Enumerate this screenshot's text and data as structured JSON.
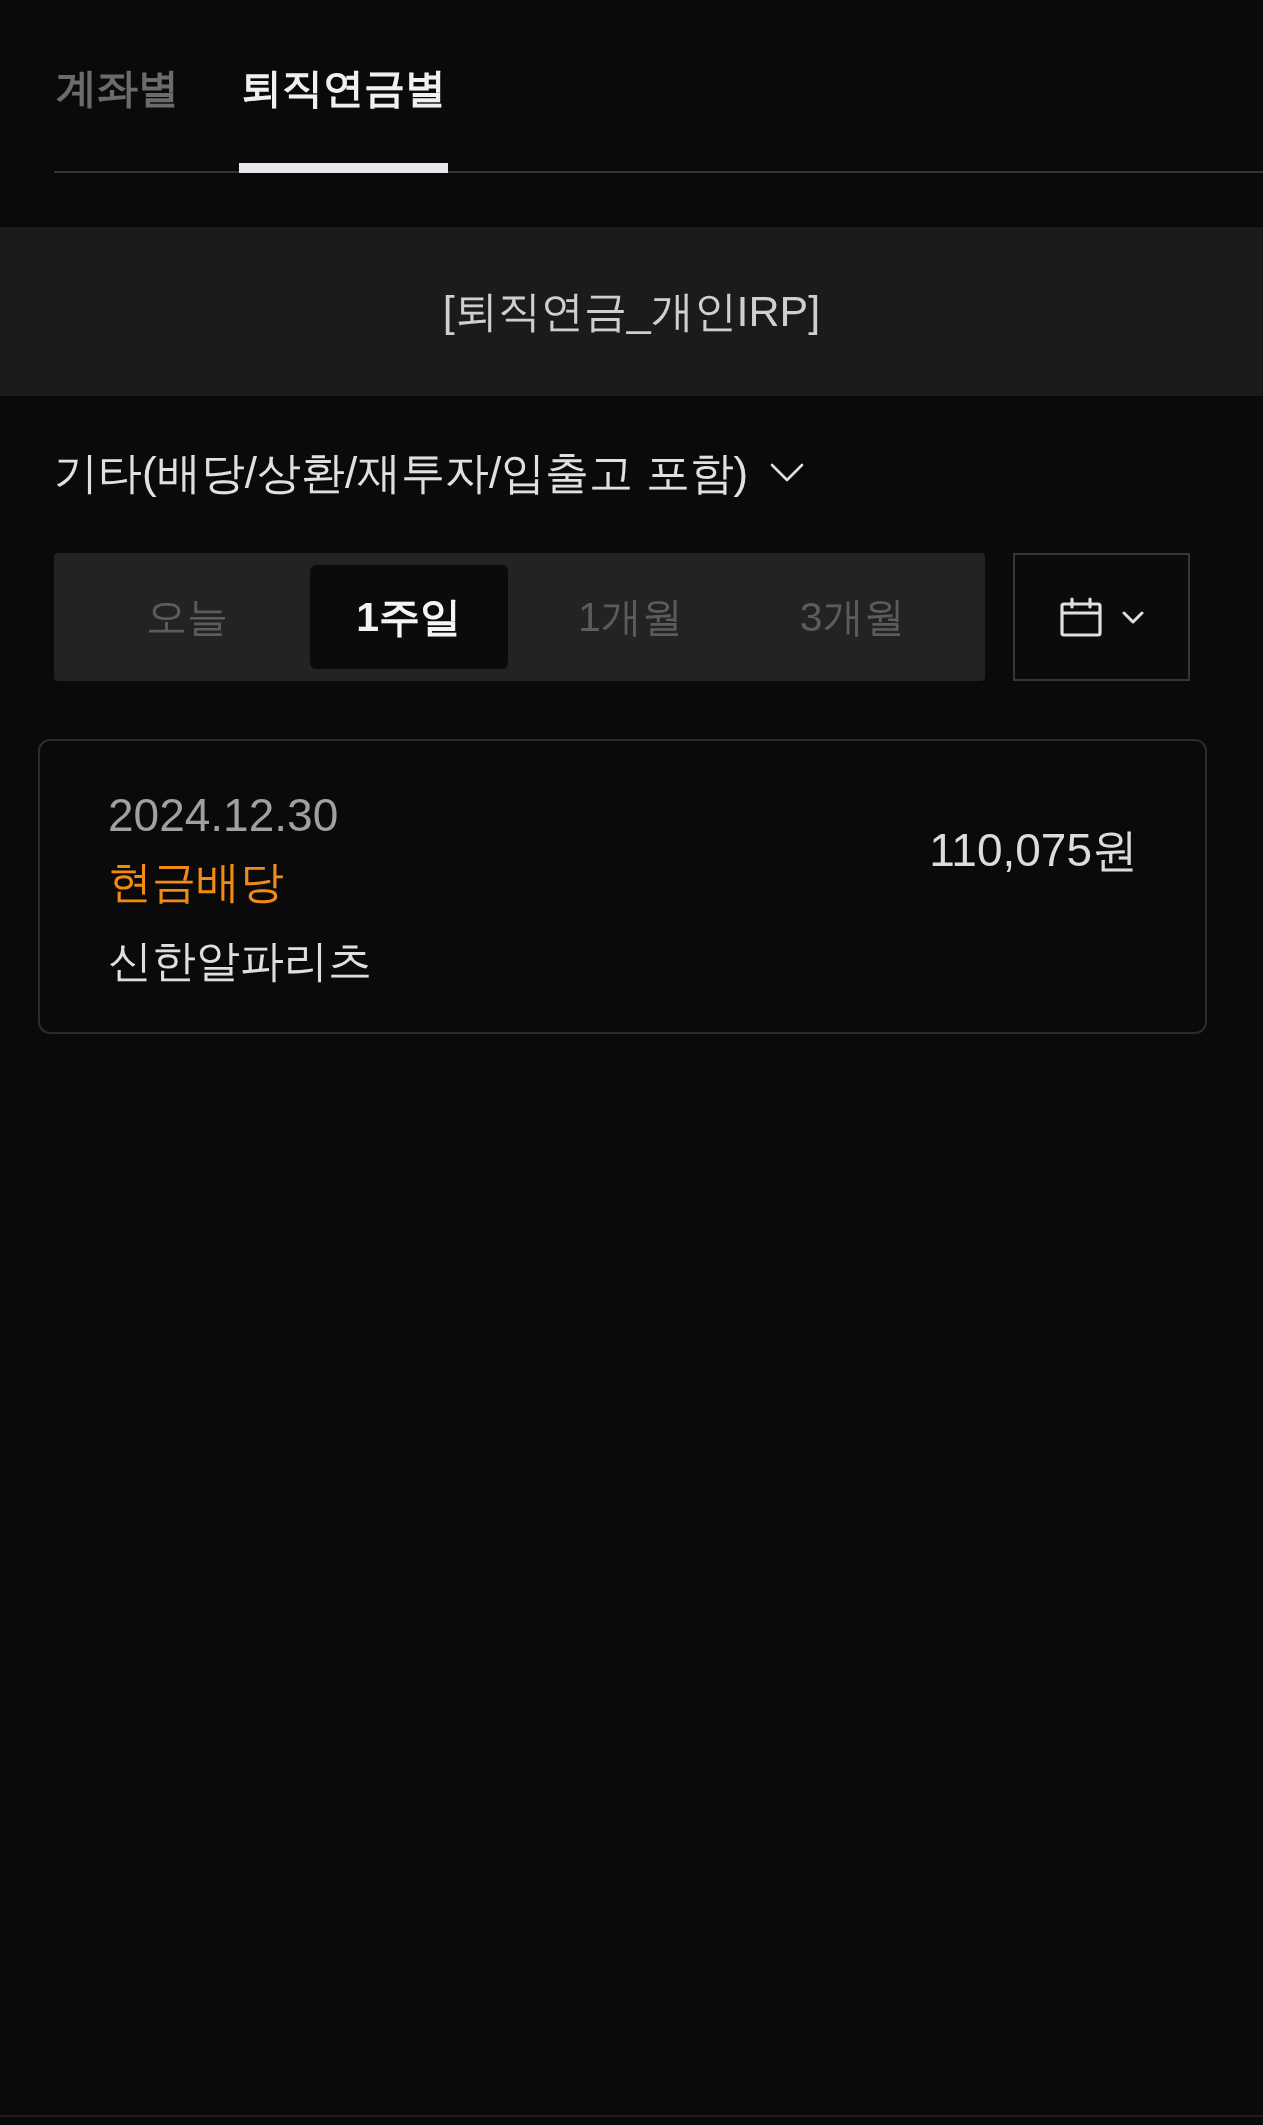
{
  "tabs": [
    {
      "label": "계좌별",
      "selected": false
    },
    {
      "label": "퇴직연금별",
      "selected": true
    }
  ],
  "account": {
    "title": "[퇴직연금_개인IRP]"
  },
  "filter": {
    "label": "기타(배당/상환/재투자/입출고 포함)"
  },
  "periods": [
    {
      "label": "오늘",
      "selected": false
    },
    {
      "label": "1주일",
      "selected": true
    },
    {
      "label": "1개월",
      "selected": false
    },
    {
      "label": "3개월",
      "selected": false
    }
  ],
  "transactions": [
    {
      "date": "2024.12.30",
      "type": "현금배당",
      "name": "신한알파리츠",
      "amount": "110,075원"
    }
  ]
}
